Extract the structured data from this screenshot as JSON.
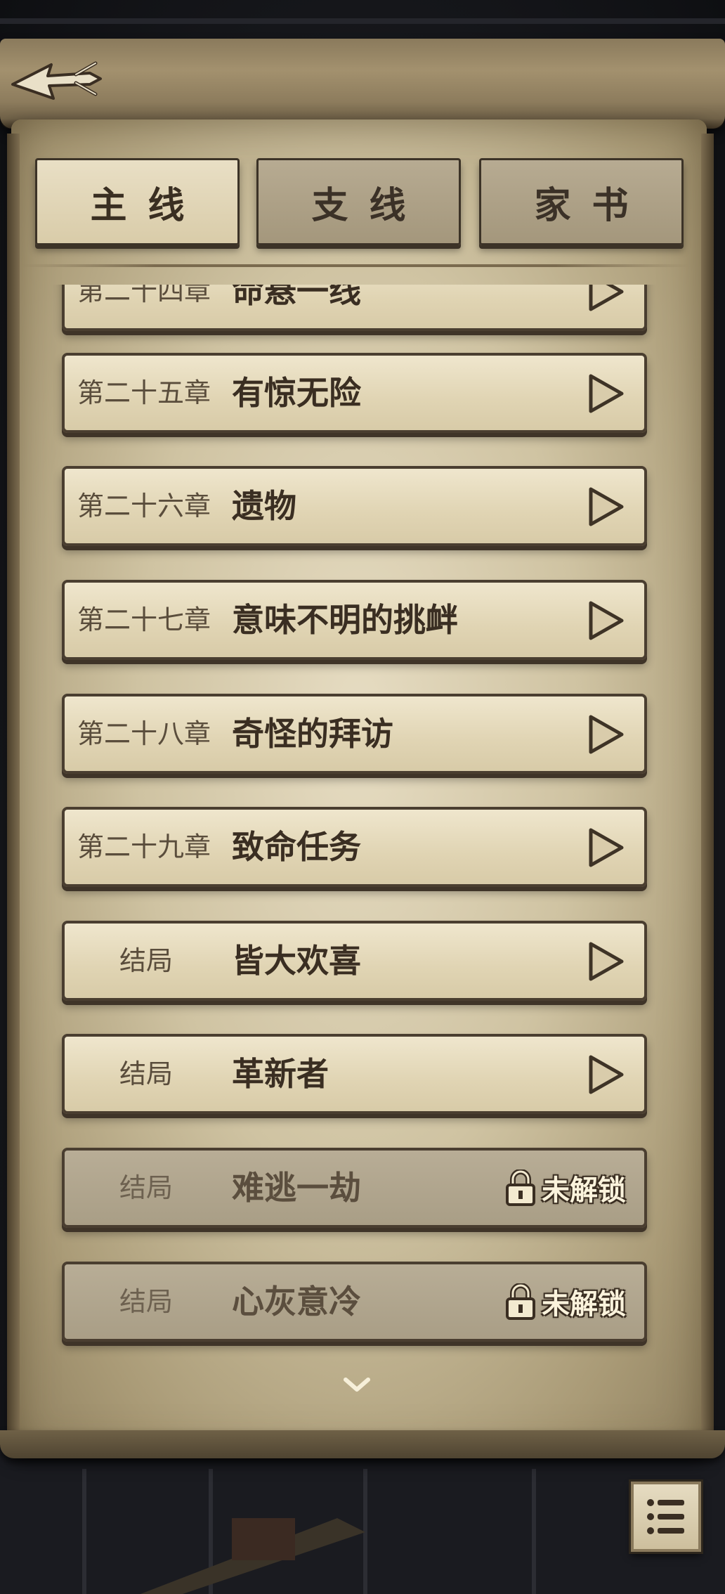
{
  "tabs": [
    {
      "label": "主线",
      "active": true
    },
    {
      "label": "支线",
      "active": false
    },
    {
      "label": "家书",
      "active": false
    }
  ],
  "chapters": [
    {
      "num": "第二十四章",
      "title": "命悬一线",
      "status": "unlocked"
    },
    {
      "num": "第二十五章",
      "title": "有惊无险",
      "status": "unlocked"
    },
    {
      "num": "第二十六章",
      "title": "遗物",
      "status": "unlocked"
    },
    {
      "num": "第二十七章",
      "title": "意味不明的挑衅",
      "status": "unlocked"
    },
    {
      "num": "第二十八章",
      "title": "奇怪的拜访",
      "status": "unlocked"
    },
    {
      "num": "第二十九章",
      "title": "致命任务",
      "status": "unlocked"
    },
    {
      "num": "结局",
      "title": "皆大欢喜",
      "status": "unlocked"
    },
    {
      "num": "结局",
      "title": "革新者",
      "status": "unlocked"
    },
    {
      "num": "结局",
      "title": "难逃一劫",
      "status": "locked"
    },
    {
      "num": "结局",
      "title": "心灰意冷",
      "status": "locked"
    }
  ],
  "locked_label": "未解锁",
  "icons": {
    "back": "back-arrow-icon",
    "play": "play-triangle-icon",
    "lock": "padlock-icon",
    "scroll_down": "chevron-down-icon",
    "menu": "list-menu-icon"
  },
  "colors": {
    "parchment": "#e0d4b3",
    "locked_row": "#a99e86",
    "ink": "#3a2e22"
  }
}
